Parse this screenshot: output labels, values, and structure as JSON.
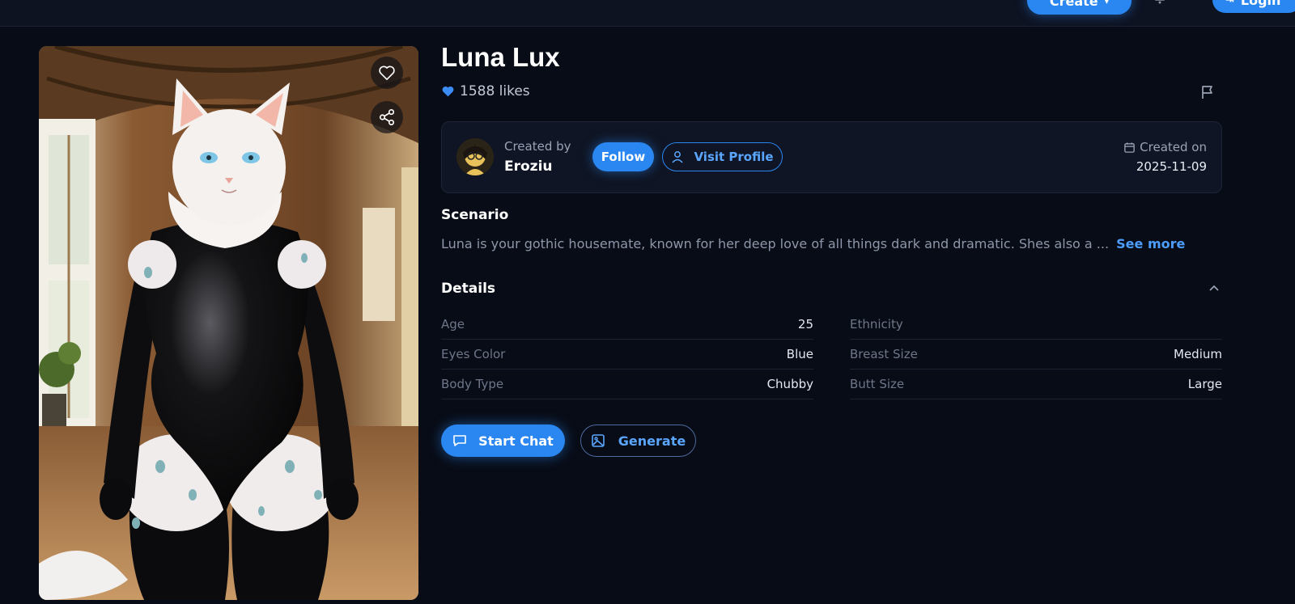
{
  "header": {
    "create_label": "Create",
    "login_label": "Login"
  },
  "character": {
    "name": "Luna Lux",
    "likes": "1588 likes"
  },
  "creator": {
    "created_by_label": "Created by",
    "name": "Eroziu",
    "follow_label": "Follow",
    "visit_profile_label": "Visit Profile",
    "created_on_label": "Created on",
    "created_on_date": "2025-11-09"
  },
  "scenario": {
    "title": "Scenario",
    "text": "Luna is your gothic housemate, known for her deep love of all things dark and dramatic. Shes also a ...",
    "see_more": "See more"
  },
  "details": {
    "title": "Details",
    "rows": [
      {
        "label": "Age",
        "value": "25"
      },
      {
        "label": "Ethnicity",
        "value": ""
      },
      {
        "label": "Eyes Color",
        "value": "Blue"
      },
      {
        "label": "Breast Size",
        "value": "Medium"
      },
      {
        "label": "Body Type",
        "value": "Chubby"
      },
      {
        "label": "Butt Size",
        "value": "Large"
      }
    ]
  },
  "actions": {
    "start_chat_label": "Start Chat",
    "generate_label": "Generate"
  },
  "colors": {
    "accent": "#2a87f2",
    "background": "#080c16",
    "card": "#0f1524"
  },
  "icons": [
    "heart-icon",
    "share-icon",
    "flag-icon",
    "user-icon",
    "calendar-icon",
    "chevron-up-icon",
    "chat-icon",
    "image-icon",
    "bell-icon"
  ]
}
